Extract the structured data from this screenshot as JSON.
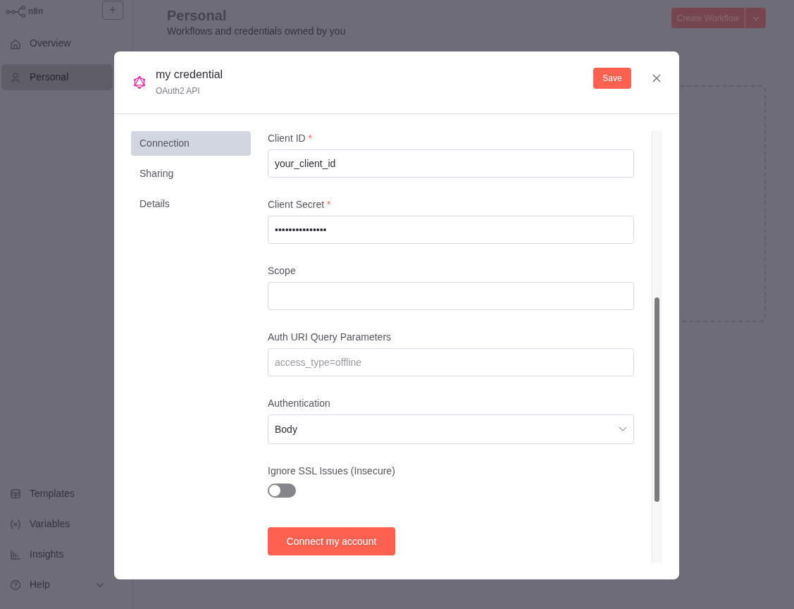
{
  "sidebar": {
    "logo_text": "n8n",
    "add_button": "+",
    "top_items": [
      {
        "label": "Overview",
        "selected": false
      },
      {
        "label": "Personal",
        "selected": true
      }
    ],
    "bottom_items": [
      {
        "label": "Templates",
        "selected": false,
        "expandable": false
      },
      {
        "label": "Variables",
        "selected": false,
        "expandable": false
      },
      {
        "label": "Insights",
        "selected": false,
        "expandable": false
      },
      {
        "label": "Help",
        "selected": false,
        "expandable": true
      }
    ]
  },
  "page": {
    "title": "Personal",
    "subtitle": "Workflows and credentials owned by you",
    "create_button": "Create Workflow"
  },
  "modal": {
    "title": "my credential",
    "subtitle": "OAuth2 API",
    "save_button": "Save",
    "tabs": [
      {
        "label": "Connection",
        "selected": true
      },
      {
        "label": "Sharing",
        "selected": false
      },
      {
        "label": "Details",
        "selected": false
      }
    ],
    "fields": [
      {
        "kind": "text",
        "label": "Client ID",
        "required_mark": "*",
        "value": "your_client_id"
      },
      {
        "kind": "text",
        "label": "Client Secret",
        "required_mark": "*",
        "value": "•••••••••••••••"
      },
      {
        "kind": "text",
        "label": "Scope"
      },
      {
        "kind": "text",
        "label": "Auth URI Query Parameters",
        "placeholder": "access_type=offline"
      },
      {
        "kind": "select",
        "label": "Authentication",
        "value": "Body"
      },
      {
        "kind": "toggle",
        "label": "Ignore SSL Issues (Insecure)",
        "on": false
      }
    ],
    "connect_button": "Connect my account"
  }
}
